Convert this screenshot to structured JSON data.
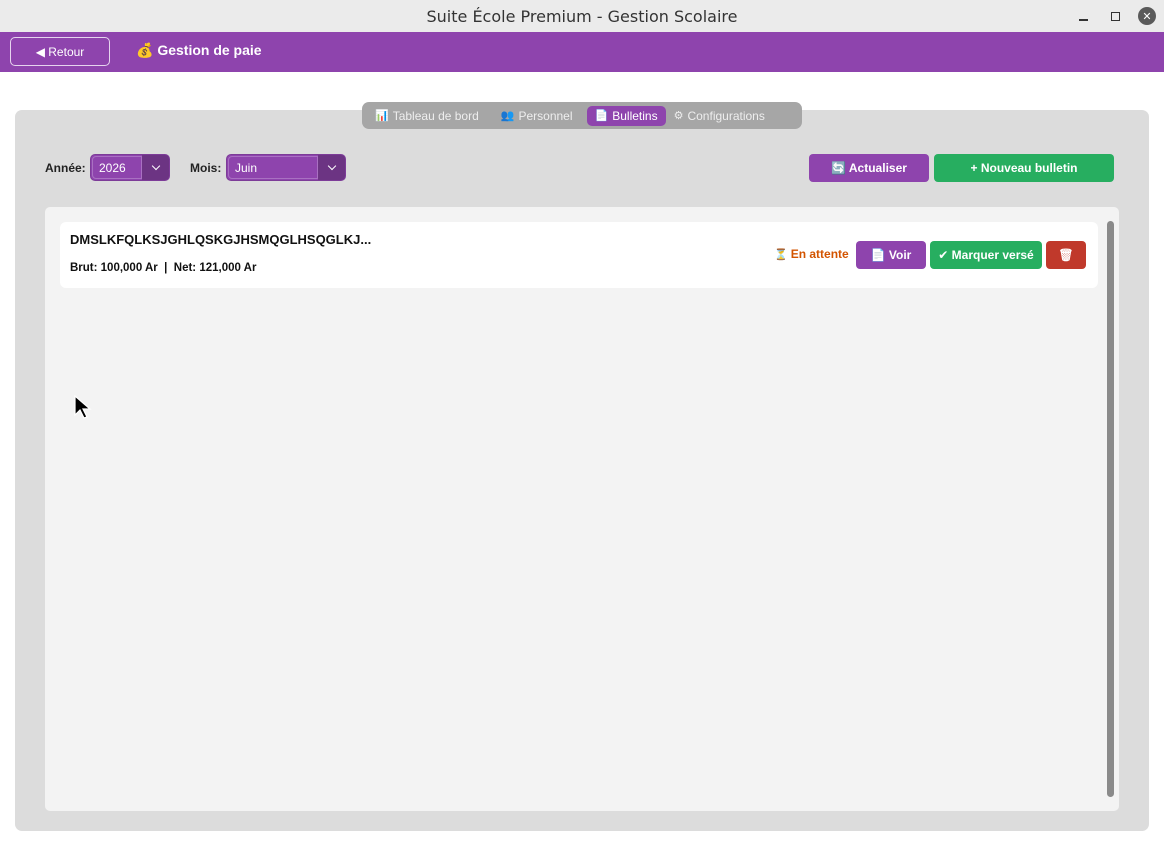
{
  "window": {
    "title": "Suite École Premium - Gestion Scolaire",
    "minimize_icon": "minimize-icon",
    "maximize_icon": "maximize-icon",
    "close_icon": "close-icon"
  },
  "header": {
    "back_label": "◀ Retour",
    "title": "💰 Gestion de paie",
    "color": "#8e44ad"
  },
  "tabs": [
    {
      "icon": "📊",
      "label": "Tableau de bord",
      "active": false
    },
    {
      "icon": "👥",
      "label": "Personnel",
      "active": false
    },
    {
      "icon": "📄",
      "label": "Bulletins",
      "active": true
    },
    {
      "icon": "⚙",
      "label": "Configurations",
      "active": false
    }
  ],
  "filters": {
    "year_label": "Année:",
    "year_value": "2026",
    "month_label": "Mois:",
    "month_value": "Juin"
  },
  "actions": {
    "refresh_label": "🔄 Actualiser",
    "new_label": "+ Nouveau bulletin"
  },
  "payslips": [
    {
      "name": "DMSLKFQLKSJGHLQSKGJHSMQGLHSQGLKJ...",
      "amounts": "Brut: 100,000 Ar  |  Net: 121,000 Ar",
      "status": "En attente",
      "status_icon": "⏳",
      "view_label": "📄 Voir",
      "mark_paid_label": "✔ Marquer versé",
      "delete_icon": "🗑"
    }
  ],
  "colors": {
    "accent": "#8e44ad",
    "success": "#27ae60",
    "danger": "#c0392b",
    "pending": "#d35400"
  }
}
